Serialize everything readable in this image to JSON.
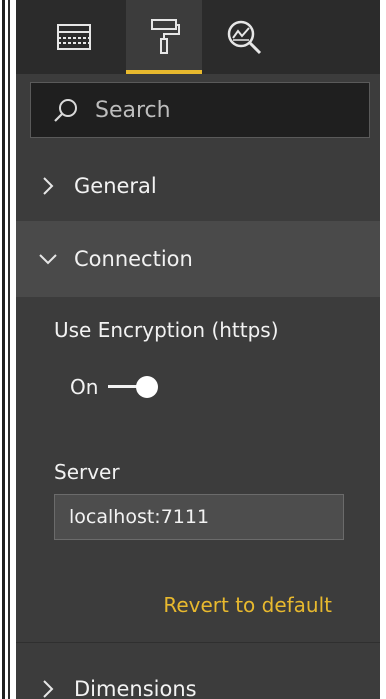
{
  "tabs": [
    {
      "icon": "fields-grid-icon",
      "active": false
    },
    {
      "icon": "paint-roller-icon",
      "active": true
    },
    {
      "icon": "analytics-magnifier-icon",
      "active": false
    }
  ],
  "search": {
    "placeholder": "Search"
  },
  "sections": {
    "general": {
      "label": "General",
      "expanded": false
    },
    "connection": {
      "label": "Connection",
      "expanded": true
    },
    "dimensions": {
      "label": "Dimensions",
      "expanded": false
    }
  },
  "connection": {
    "encryption_label": "Use Encryption (https)",
    "encryption_state": "On",
    "encryption_enabled": true,
    "server_label": "Server",
    "server_value": "localhost:7111",
    "revert_label": "Revert to default"
  },
  "colors": {
    "accent": "#e8b92e",
    "panel_bg": "#3c3c3c",
    "tabbar_bg": "#2b2b2b",
    "search_bg": "#1f1f1f"
  }
}
